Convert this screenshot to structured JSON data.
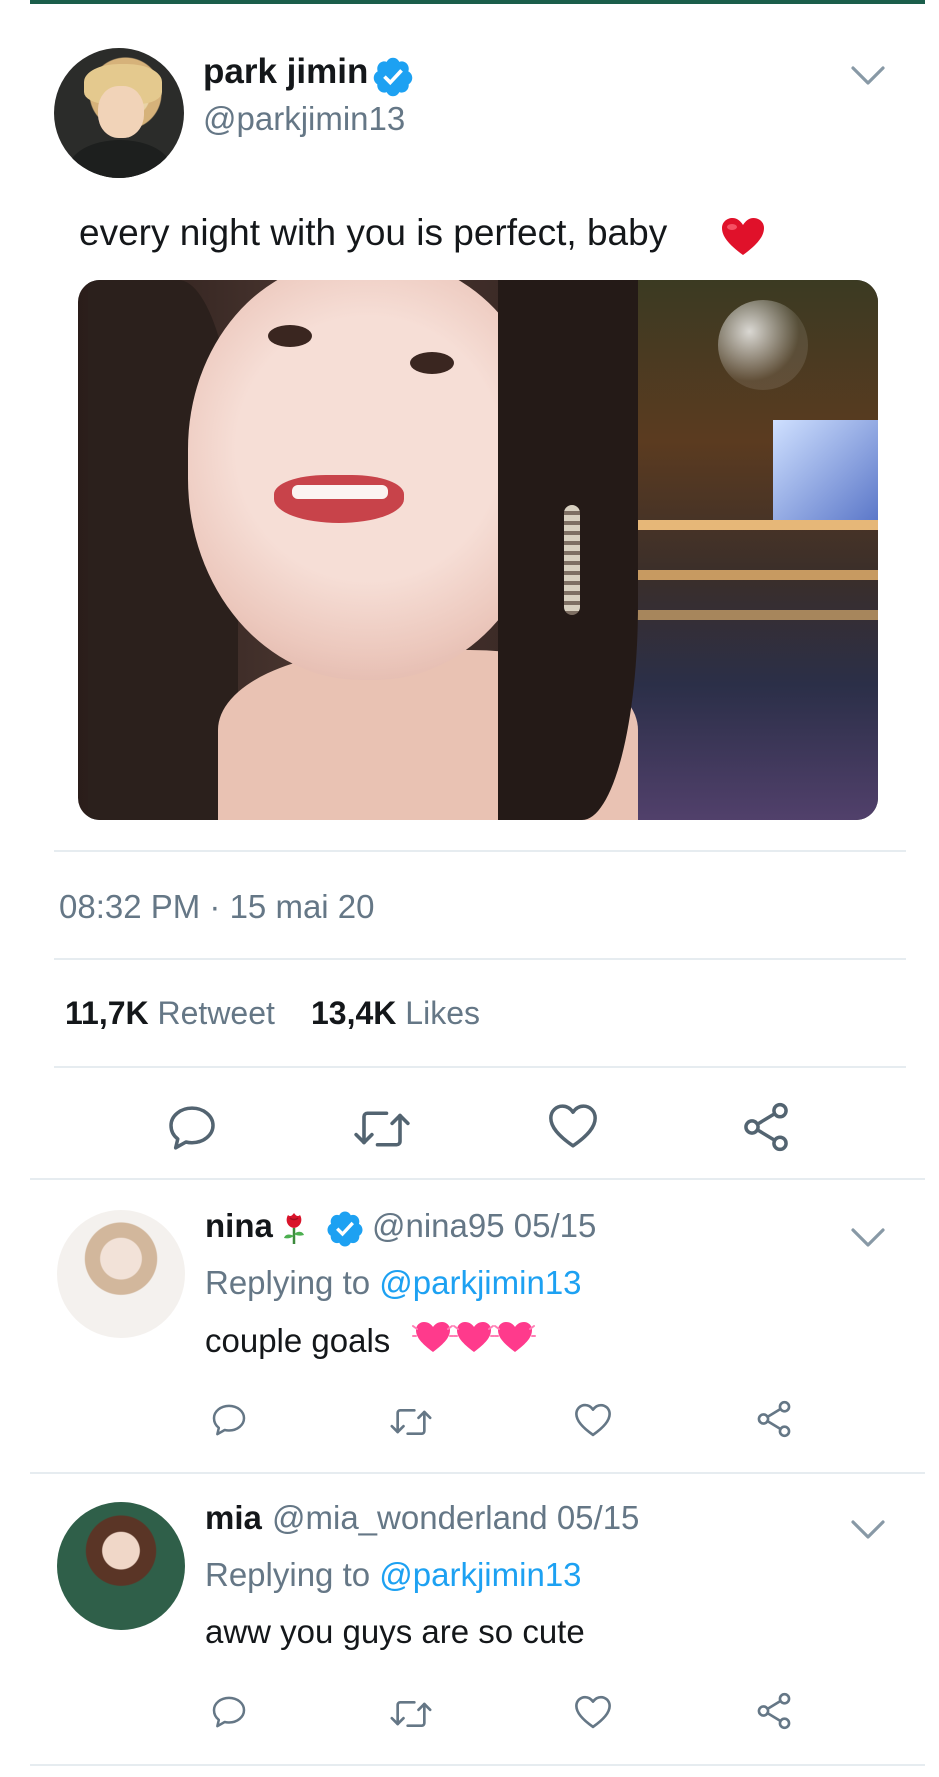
{
  "tweet": {
    "author_name": "park jimin",
    "author_handle": "@parkjimin13",
    "text": "every night with you is perfect, baby",
    "text_emoji": "red-heart-emoji",
    "timestamp": "08:32 PM · 15 mai 20",
    "retweet_count": "11,7K",
    "retweet_label": "Retweet",
    "likes_count": "13,4K",
    "likes_label": "Likes"
  },
  "icons": {
    "menu": "chevron-down-icon",
    "verified": "verified-badge-icon",
    "reply": "reply-icon",
    "retweet": "retweet-icon",
    "like": "heart-icon",
    "share": "share-icon"
  },
  "replies": [
    {
      "name": "nina",
      "name_emoji": "rose-emoji",
      "verified": true,
      "handle": "@nina95",
      "date": "05/15",
      "replying_prefix": "Replying to",
      "replying_to": "@parkjimin13",
      "text": "couple goals",
      "text_emoji": "beating-heart-emoji x3"
    },
    {
      "name": "mia",
      "verified": false,
      "handle": "@mia_wonderland",
      "date": "05/15",
      "replying_prefix": "Replying to",
      "replying_to": "@parkjimin13",
      "text": "aww you guys are so cute"
    }
  ],
  "colors": {
    "accent": "#1da1f2",
    "muted": "#657786",
    "text": "#14171a",
    "top_bar": "#1b5e4b",
    "divider": "#e6ecf0"
  }
}
